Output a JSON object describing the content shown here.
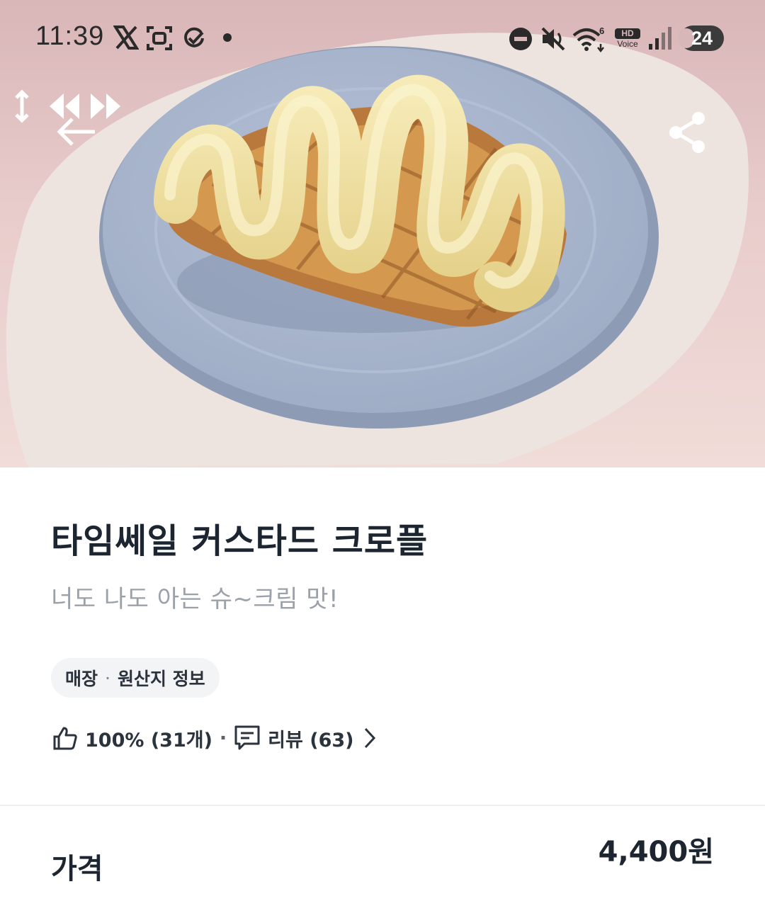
{
  "status_bar": {
    "time": "11:39",
    "icons": [
      "x-app-icon",
      "screenshot-icon",
      "check-circle-icon",
      "dot-icon",
      "dnd-icon",
      "mute-icon",
      "wifi-icon",
      "hd-voice-icon",
      "signal-icon"
    ],
    "wifi_badge": "6",
    "hd_top": "HD",
    "hd_bottom": "Voice",
    "battery": "24"
  },
  "product": {
    "title": "타임쎄일 커스타드 크로플",
    "subtitle": "너도 나도 아는 슈~크림 맛!",
    "info_chip": {
      "part1": "매장",
      "separator": "·",
      "part2": "원산지 정보"
    },
    "rating": "100% (31개)",
    "stats_separator": "·",
    "reviews": "리뷰 (63)",
    "price_label": "가격",
    "price": "4,400원"
  },
  "colors": {
    "text_primary": "#1c2530",
    "text_secondary": "#9ba1a9",
    "chip_bg": "#f3f4f6",
    "plate": "#a9b6cd"
  }
}
